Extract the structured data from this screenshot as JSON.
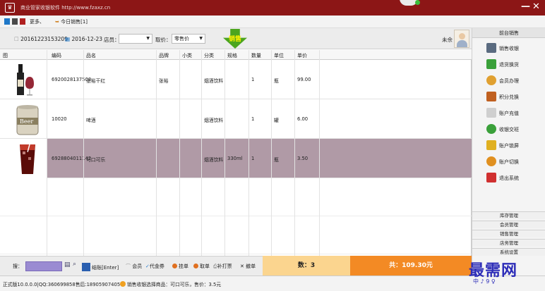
{
  "window": {
    "title": "商业管家收银软件 http://www.fzaxz.cn",
    "minimize_label": "—",
    "close_label": "✕"
  },
  "menubar": {
    "items": [
      "更多",
      "今日销售[1]"
    ],
    "colors": [
      "#1f78c8",
      "#4a4a4a",
      "#b02020"
    ]
  },
  "toolbar": {
    "order_no": "20161223153209",
    "date": "2016-12-23",
    "store_label": "店员：",
    "store_value": "",
    "price_label": "取价：",
    "price_value": "零售价",
    "sale_button": "销售",
    "member_label": "未佘"
  },
  "table": {
    "headers": [
      "图",
      "编码",
      "品名",
      "品牌",
      "小类",
      "分类",
      "规格",
      "数量",
      "单位",
      "单价"
    ],
    "rows": [
      {
        "code": "6920028137508",
        "name": "张裕干红",
        "brand": "张裕",
        "subcat": "",
        "category": "烟酒饮料",
        "spec": "",
        "qty": "1",
        "unit": "瓶",
        "price": "99.00",
        "image": "wine-bottle-icon",
        "selected": false
      },
      {
        "code": "10020",
        "name": "啤酒",
        "brand": "",
        "subcat": "",
        "category": "烟酒饮料",
        "spec": "",
        "qty": "1",
        "unit": "罐",
        "price": "6.00",
        "image": "beer-can-icon",
        "selected": false
      },
      {
        "code": "6928804011142",
        "name": "可口可乐",
        "brand": "",
        "subcat": "",
        "category": "烟酒饮料",
        "spec": "330ml",
        "qty": "1",
        "unit": "瓶",
        "price": "3.50",
        "image": "cola-glass-icon",
        "selected": true
      }
    ]
  },
  "bottombar": {
    "scan_label": "搜：",
    "settle": "结账[Enter]",
    "member": "会员",
    "voucher": "代金券",
    "hang": "挂单",
    "take": "取单",
    "reprint": "补打票",
    "cancel": "撤单",
    "qty_summary": "数：3",
    "total_summary": "共：109.30元"
  },
  "status": {
    "version": "正式版10.0.0.0|QQ:360699858售后:18905907405",
    "hint": "销售收银选择商品：可口可乐，售价：3.5元"
  },
  "sidebar": {
    "header": "前台销售",
    "items": [
      {
        "label": "销售收银",
        "icon": "cash-register-icon",
        "color": "#5a6b80"
      },
      {
        "label": "退货换货",
        "icon": "return-goods-icon",
        "color": "#3aa03a"
      },
      {
        "label": "会员办理",
        "icon": "member-icon",
        "color": "#e0a030"
      },
      {
        "label": "积分兑换",
        "icon": "points-icon",
        "color": "#c06020"
      },
      {
        "label": "账户充值",
        "icon": "recharge-icon",
        "color": "#b0b0b0"
      },
      {
        "label": "收银交班",
        "icon": "shift-change-icon",
        "color": "#3aa03a"
      },
      {
        "label": "账户锁屏",
        "icon": "lock-icon",
        "color": "#e0b020"
      },
      {
        "label": "账户切换",
        "icon": "switch-user-icon",
        "color": "#e09020"
      },
      {
        "label": "退出系统",
        "icon": "power-icon",
        "color": "#d03030"
      }
    ],
    "sections": [
      "库存管理",
      "会员管理",
      "销售管理",
      "店务管理",
      "系统设置"
    ]
  },
  "watermark": {
    "main": "最需网",
    "sub": "中 ♪ 9 ♀"
  }
}
